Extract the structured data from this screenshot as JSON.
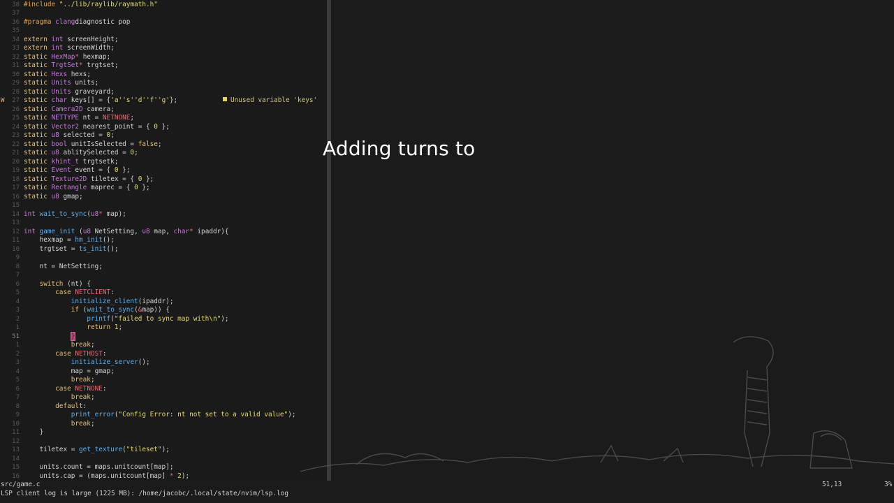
{
  "editor": {
    "lines": [
      {
        "num": "38",
        "sign": "",
        "tokens": [
          [
            "pp",
            "#include "
          ],
          [
            "str",
            "\"../lib/raylib/raymath.h\""
          ]
        ]
      },
      {
        "num": "37",
        "sign": "",
        "tokens": []
      },
      {
        "num": "36",
        "sign": "",
        "tokens": [
          [
            "pp",
            "#pragma "
          ],
          [
            "ty",
            "clang"
          ],
          [
            "",
            "diagnostic pop"
          ]
        ]
      },
      {
        "num": "35",
        "sign": "",
        "tokens": []
      },
      {
        "num": "34",
        "sign": "",
        "tokens": [
          [
            "kw",
            "extern "
          ],
          [
            "ty",
            "int"
          ],
          [
            "",
            " screenHeight;"
          ]
        ]
      },
      {
        "num": "33",
        "sign": "",
        "tokens": [
          [
            "kw",
            "extern "
          ],
          [
            "ty",
            "int"
          ],
          [
            "",
            " screenWidth;"
          ]
        ]
      },
      {
        "num": "32",
        "sign": "",
        "tokens": [
          [
            "kw",
            "static "
          ],
          [
            "ty",
            "HexMap"
          ],
          [
            "cst",
            "*"
          ],
          [
            "",
            " hexmap;"
          ]
        ]
      },
      {
        "num": "31",
        "sign": "",
        "tokens": [
          [
            "kw",
            "static "
          ],
          [
            "ty",
            "TrgtSet"
          ],
          [
            "cst",
            "*"
          ],
          [
            "",
            " trgtset;"
          ]
        ]
      },
      {
        "num": "30",
        "sign": "",
        "tokens": [
          [
            "kw",
            "static "
          ],
          [
            "ty",
            "Hexs"
          ],
          [
            "",
            " hexs;"
          ]
        ]
      },
      {
        "num": "29",
        "sign": "",
        "tokens": [
          [
            "kw",
            "static "
          ],
          [
            "ty",
            "Units"
          ],
          [
            "",
            " units;"
          ]
        ]
      },
      {
        "num": "28",
        "sign": "",
        "tokens": [
          [
            "kw",
            "static "
          ],
          [
            "ty",
            "Units"
          ],
          [
            "",
            " graveyard;"
          ]
        ]
      },
      {
        "num": "27",
        "sign": "W",
        "tokens": [
          [
            "kw",
            "static "
          ],
          [
            "ty",
            "char"
          ],
          [
            "",
            " keys[] = {"
          ],
          [
            "str",
            "'a'"
          ],
          [
            ", "
          ],
          [
            "str",
            "'s'"
          ],
          [
            ", "
          ],
          [
            "str",
            "'d'"
          ],
          [
            ", "
          ],
          [
            "str",
            "'f'"
          ],
          [
            ", "
          ],
          [
            "str",
            "'g'"
          ],
          [
            "",
            "};"
          ]
        ],
        "diag": "Unused variable 'keys'"
      },
      {
        "num": "26",
        "sign": "",
        "tokens": [
          [
            "kw",
            "static "
          ],
          [
            "ty",
            "Camera2D"
          ],
          [
            "",
            " camera;"
          ]
        ]
      },
      {
        "num": "25",
        "sign": "",
        "tokens": [
          [
            "kw",
            "static "
          ],
          [
            "ty",
            "NETTYPE"
          ],
          [
            "",
            " nt = "
          ],
          [
            "cst",
            "NETNONE"
          ],
          [
            "",
            ";"
          ]
        ]
      },
      {
        "num": "24",
        "sign": "",
        "tokens": [
          [
            "kw",
            "static "
          ],
          [
            "ty",
            "Vector2"
          ],
          [
            "",
            " nearest_point = { "
          ],
          [
            "num",
            "0"
          ],
          [
            "",
            " };"
          ]
        ]
      },
      {
        "num": "23",
        "sign": "",
        "tokens": [
          [
            "kw",
            "static "
          ],
          [
            "ty",
            "u8"
          ],
          [
            "",
            " selected = "
          ],
          [
            "num",
            "0"
          ],
          [
            "",
            ";"
          ]
        ]
      },
      {
        "num": "22",
        "sign": "",
        "tokens": [
          [
            "kw",
            "static "
          ],
          [
            "ty",
            "bool"
          ],
          [
            "",
            " unitIsSelected = "
          ],
          [
            "kw",
            "false"
          ],
          [
            "",
            ";"
          ]
        ]
      },
      {
        "num": "21",
        "sign": "",
        "tokens": [
          [
            "kw",
            "static "
          ],
          [
            "ty",
            "u8"
          ],
          [
            "",
            " ablitySelected = "
          ],
          [
            "num",
            "0"
          ],
          [
            "",
            ";"
          ]
        ]
      },
      {
        "num": "20",
        "sign": "",
        "tokens": [
          [
            "kw",
            "static "
          ],
          [
            "ty",
            "khint_t"
          ],
          [
            "",
            " trgtsetk;"
          ]
        ]
      },
      {
        "num": "19",
        "sign": "",
        "tokens": [
          [
            "kw",
            "static "
          ],
          [
            "ty",
            "Event"
          ],
          [
            "",
            " event = { "
          ],
          [
            "num",
            "0"
          ],
          [
            "",
            " };"
          ]
        ]
      },
      {
        "num": "18",
        "sign": "",
        "tokens": [
          [
            "kw",
            "static "
          ],
          [
            "ty",
            "Texture2D"
          ],
          [
            "",
            " tiletex = { "
          ],
          [
            "num",
            "0"
          ],
          [
            "",
            " };"
          ]
        ]
      },
      {
        "num": "17",
        "sign": "",
        "tokens": [
          [
            "kw",
            "static "
          ],
          [
            "ty",
            "Rectangle"
          ],
          [
            "",
            " maprec = { "
          ],
          [
            "num",
            "0"
          ],
          [
            "",
            " };"
          ]
        ]
      },
      {
        "num": "16",
        "sign": "",
        "tokens": [
          [
            "kw",
            "static "
          ],
          [
            "ty",
            "u8"
          ],
          [
            "",
            " gmap;"
          ]
        ]
      },
      {
        "num": "15",
        "sign": "",
        "tokens": []
      },
      {
        "num": "14",
        "sign": "",
        "tokens": [
          [
            "ty",
            "int"
          ],
          [
            "fn",
            " wait_to_sync"
          ],
          [
            "",
            "("
          ],
          [
            "ty",
            "u8"
          ],
          [
            "cst",
            "*"
          ],
          [
            "",
            " map);"
          ]
        ]
      },
      {
        "num": "13",
        "sign": "",
        "tokens": []
      },
      {
        "num": "12",
        "sign": "",
        "tokens": [
          [
            "ty",
            "int"
          ],
          [
            "fn",
            " game_init"
          ],
          [
            "",
            " ("
          ],
          [
            "ty",
            "u8"
          ],
          [
            "",
            " NetSetting, "
          ],
          [
            "ty",
            "u8"
          ],
          [
            "",
            " map, "
          ],
          [
            "ty",
            "char"
          ],
          [
            "cst",
            "*"
          ],
          [
            "",
            " ipaddr){"
          ]
        ]
      },
      {
        "num": "11",
        "sign": "",
        "tokens": [
          [
            "",
            "    hexmap = "
          ],
          [
            "fn",
            "hm_init"
          ],
          [
            "",
            "();"
          ]
        ]
      },
      {
        "num": "10",
        "sign": "",
        "tokens": [
          [
            "",
            "    trgtset = "
          ],
          [
            "fn",
            "ts_init"
          ],
          [
            "",
            "();"
          ]
        ]
      },
      {
        "num": "9",
        "sign": "",
        "tokens": []
      },
      {
        "num": "8",
        "sign": "",
        "tokens": [
          [
            "",
            "    nt = NetSetting;"
          ]
        ]
      },
      {
        "num": "7",
        "sign": "",
        "tokens": []
      },
      {
        "num": "6",
        "sign": "",
        "tokens": [
          [
            "",
            "    "
          ],
          [
            "kw",
            "switch"
          ],
          [
            "",
            " (nt) {"
          ]
        ]
      },
      {
        "num": "5",
        "sign": "",
        "tokens": [
          [
            "",
            "        "
          ],
          [
            "kw",
            "case "
          ],
          [
            "cst",
            "NETCLIENT"
          ],
          [
            "",
            ":"
          ]
        ]
      },
      {
        "num": "4",
        "sign": "",
        "tokens": [
          [
            "",
            "            "
          ],
          [
            "fn",
            "initialize_client"
          ],
          [
            "",
            "(ipaddr);"
          ]
        ]
      },
      {
        "num": "3",
        "sign": "",
        "tokens": [
          [
            "",
            "            "
          ],
          [
            "kw",
            "if"
          ],
          [
            "",
            " ("
          ],
          [
            "fn",
            "wait_to_sync"
          ],
          [
            "",
            "("
          ],
          [
            "cst",
            "&"
          ],
          [
            "",
            "map)) {"
          ]
        ]
      },
      {
        "num": "2",
        "sign": "",
        "tokens": [
          [
            "",
            "                "
          ],
          [
            "fn",
            "printf"
          ],
          [
            "",
            "("
          ],
          [
            "str",
            "\"failed to sync map with\\n\""
          ],
          [
            "",
            ");"
          ]
        ]
      },
      {
        "num": "1",
        "sign": "",
        "tokens": [
          [
            "",
            "                "
          ],
          [
            "kw",
            "return"
          ],
          [
            "",
            " "
          ],
          [
            "num",
            "1"
          ],
          [
            "",
            ";"
          ]
        ]
      },
      {
        "num": "51",
        "sign": "",
        "cur": true,
        "tokens": [
          [
            "",
            "            "
          ],
          [
            "cursor",
            "}"
          ]
        ]
      },
      {
        "num": "1",
        "sign": "",
        "tokens": [
          [
            "",
            "            "
          ],
          [
            "kw",
            "break"
          ],
          [
            "",
            ";"
          ]
        ]
      },
      {
        "num": "2",
        "sign": "",
        "tokens": [
          [
            "",
            "        "
          ],
          [
            "kw",
            "case "
          ],
          [
            "cst",
            "NETHOST"
          ],
          [
            "",
            ":"
          ]
        ]
      },
      {
        "num": "3",
        "sign": "",
        "tokens": [
          [
            "",
            "            "
          ],
          [
            "fn",
            "initialize_server"
          ],
          [
            "",
            "();"
          ]
        ]
      },
      {
        "num": "4",
        "sign": "",
        "tokens": [
          [
            "",
            "            map = gmap;"
          ]
        ]
      },
      {
        "num": "5",
        "sign": "",
        "tokens": [
          [
            "",
            "            "
          ],
          [
            "kw",
            "break"
          ],
          [
            "",
            ";"
          ]
        ]
      },
      {
        "num": "6",
        "sign": "",
        "tokens": [
          [
            "",
            "        "
          ],
          [
            "kw",
            "case "
          ],
          [
            "cst",
            "NETNONE"
          ],
          [
            "",
            ":"
          ]
        ]
      },
      {
        "num": "7",
        "sign": "",
        "tokens": [
          [
            "",
            "            "
          ],
          [
            "kw",
            "break"
          ],
          [
            "",
            ";"
          ]
        ]
      },
      {
        "num": "8",
        "sign": "",
        "tokens": [
          [
            "",
            "        "
          ],
          [
            "kw",
            "default"
          ],
          [
            "",
            ":"
          ]
        ]
      },
      {
        "num": "9",
        "sign": "",
        "tokens": [
          [
            "",
            "            "
          ],
          [
            "fn",
            "print_error"
          ],
          [
            "",
            "("
          ],
          [
            "str",
            "\"Config Error: nt not set to a valid value\""
          ],
          [
            "",
            ");"
          ]
        ]
      },
      {
        "num": "10",
        "sign": "",
        "tokens": [
          [
            "",
            "            "
          ],
          [
            "kw",
            "break"
          ],
          [
            "",
            ";"
          ]
        ]
      },
      {
        "num": "11",
        "sign": "",
        "tokens": [
          [
            "",
            "    }"
          ]
        ]
      },
      {
        "num": "12",
        "sign": "",
        "tokens": []
      },
      {
        "num": "13",
        "sign": "",
        "tokens": [
          [
            "",
            "    tiletex = "
          ],
          [
            "fn",
            "get_texture"
          ],
          [
            "",
            "("
          ],
          [
            "str",
            "\"tileset\""
          ],
          [
            "",
            ");"
          ]
        ]
      },
      {
        "num": "14",
        "sign": "",
        "tokens": []
      },
      {
        "num": "15",
        "sign": "",
        "tokens": [
          [
            "",
            "    units.count = maps.unitcount[map];"
          ]
        ]
      },
      {
        "num": "16",
        "sign": "",
        "tokens": [
          [
            "",
            "    units.cap = (maps.unitcount[map] "
          ],
          [
            "cst",
            "*"
          ],
          [
            "",
            " "
          ],
          [
            "num",
            "2"
          ],
          [
            "",
            ");"
          ]
        ]
      }
    ]
  },
  "overlay": {
    "text": "Adding turns to"
  },
  "statusline": {
    "file": "src/game.c",
    "position": "51,13",
    "percent": "3%"
  },
  "cmdline": {
    "message": "LSP client log is large (1225 MB): /home/jacobc/.local/state/nvim/lsp.log"
  },
  "colors": {
    "background": "#1b1b1b",
    "cursor": "#c8417a",
    "warning": "#e6d85a"
  }
}
